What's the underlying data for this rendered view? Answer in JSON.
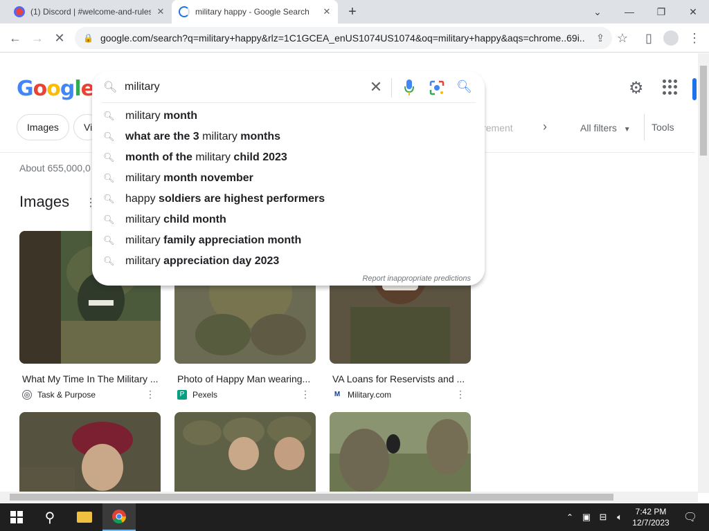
{
  "browser": {
    "tabs": [
      {
        "title": "(1) Discord | #welcome-and-rules",
        "active": false
      },
      {
        "title": "military happy - Google Search",
        "active": true
      }
    ],
    "url": "google.com/search?q=military+happy&rlz=1C1GCEA_enUS1074US1074&oq=military+happy&aqs=chrome..69i..."
  },
  "google": {
    "logo_letters": [
      "G",
      "o",
      "o",
      "g",
      "l",
      "e"
    ],
    "search_value": "military ",
    "suggestions": [
      {
        "normal": "military ",
        "bold": "month",
        "order": "nb"
      },
      {
        "bold1": "what are the 3 ",
        "normal": "military",
        "bold": " months",
        "order": "bnb"
      },
      {
        "bold1": "month of the ",
        "normal": "military",
        "bold": " child 2023",
        "order": "bnb"
      },
      {
        "normal": "military ",
        "bold": "month november",
        "order": "nb"
      },
      {
        "normal": "happy ",
        "bold": "soldiers are highest performers",
        "order": "nb"
      },
      {
        "normal": "military ",
        "bold": "child month",
        "order": "nb"
      },
      {
        "normal": "military ",
        "bold": "family appreciation month",
        "order": "nb"
      },
      {
        "normal": "military ",
        "bold": "appreciation day 2023",
        "order": "nb"
      }
    ],
    "report_link": "Report inappropriate predictions",
    "chips": [
      "Images",
      "Vi"
    ],
    "chip_partial": "irement",
    "all_filters": "All filters",
    "tools": "Tools",
    "result_count": "About 655,000,0",
    "images_heading": "Images"
  },
  "image_results": [
    {
      "caption": "What My Time In The Military ...",
      "source": "Task & Purpose",
      "color": "#4a5a3a"
    },
    {
      "caption": "Photo of Happy Man wearing...",
      "source": "Pexels",
      "color": "#6b6a52"
    },
    {
      "caption": "VA Loans for Reservists and ...",
      "source": "Military.com",
      "color": "#5c5440"
    }
  ],
  "image_results_row2": [
    {
      "color": "#55533f"
    },
    {
      "color": "#5f6147"
    },
    {
      "color": "#6c7650"
    }
  ],
  "taskbar": {
    "time": "7:42 PM",
    "date": "12/7/2023"
  }
}
